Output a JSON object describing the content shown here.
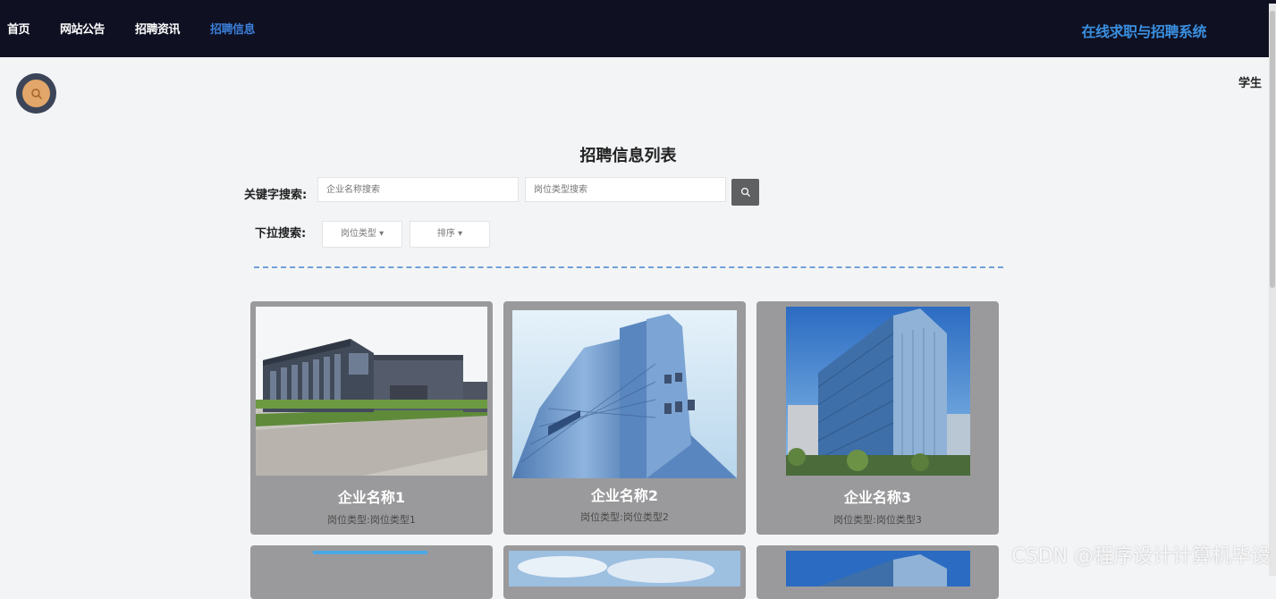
{
  "nav": {
    "items": [
      {
        "label": "首页"
      },
      {
        "label": "网站公告"
      },
      {
        "label": "招聘资讯"
      },
      {
        "label": "招聘信息"
      }
    ],
    "active_item": "招聘信息",
    "site_title": "在线求职与招聘系统"
  },
  "user": {
    "role": "学生",
    "avatar_icon": "search-icon"
  },
  "main": {
    "title": "招聘信息列表",
    "keyword_label": "关键字搜索:",
    "company_placeholder": "企业名称搜索",
    "position_placeholder": "岗位类型搜索",
    "search_button_icon": "search-icon",
    "dropdown_label": "下拉搜索:",
    "dropdowns": [
      {
        "label": "岗位类型 ▾"
      },
      {
        "label": "排序 ▾"
      }
    ]
  },
  "cards": [
    {
      "name": "企业名称1",
      "type": "岗位类型:岗位类型1"
    },
    {
      "name": "企业名称2",
      "type": "岗位类型:岗位类型2"
    },
    {
      "name": "企业名称3",
      "type": "岗位类型:岗位类型3"
    }
  ],
  "watermark": "CSDN @程序设计计算机毕设",
  "colors": {
    "topbar": "#0f1022",
    "active_nav": "#3b7fd8",
    "site_title": "#3a8fe0",
    "card_bg": "#9a9a9c",
    "divider": "#6fa0d8"
  }
}
